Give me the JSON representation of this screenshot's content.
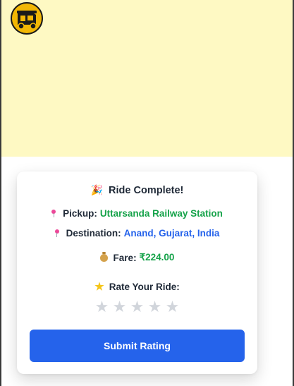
{
  "card": {
    "title": "Ride Complete!",
    "pickup_label": "Pickup:",
    "pickup_value": "Uttarsanda Railway Station",
    "destination_label": "Destination:",
    "destination_value": "Anand, Gujarat, India",
    "fare_label": "Fare:",
    "fare_value": "₹224.00",
    "rate_label": "Rate Your Ride:",
    "stars": [
      "★",
      "★",
      "★",
      "★",
      "★"
    ],
    "rating_selected": 0,
    "submit_label": "Submit Rating"
  },
  "icons": {
    "logo": "auto-rickshaw-logo",
    "title": "party-popper-icon",
    "pickup": "pin-icon",
    "destination": "pin-icon",
    "fare": "money-bag-icon",
    "rate": "star-icon"
  },
  "colors": {
    "map_background": "#fef9c3",
    "green_value": "#16a34a",
    "blue_value": "#2563eb",
    "button": "#2563eb",
    "star_empty": "#d1d5db"
  }
}
